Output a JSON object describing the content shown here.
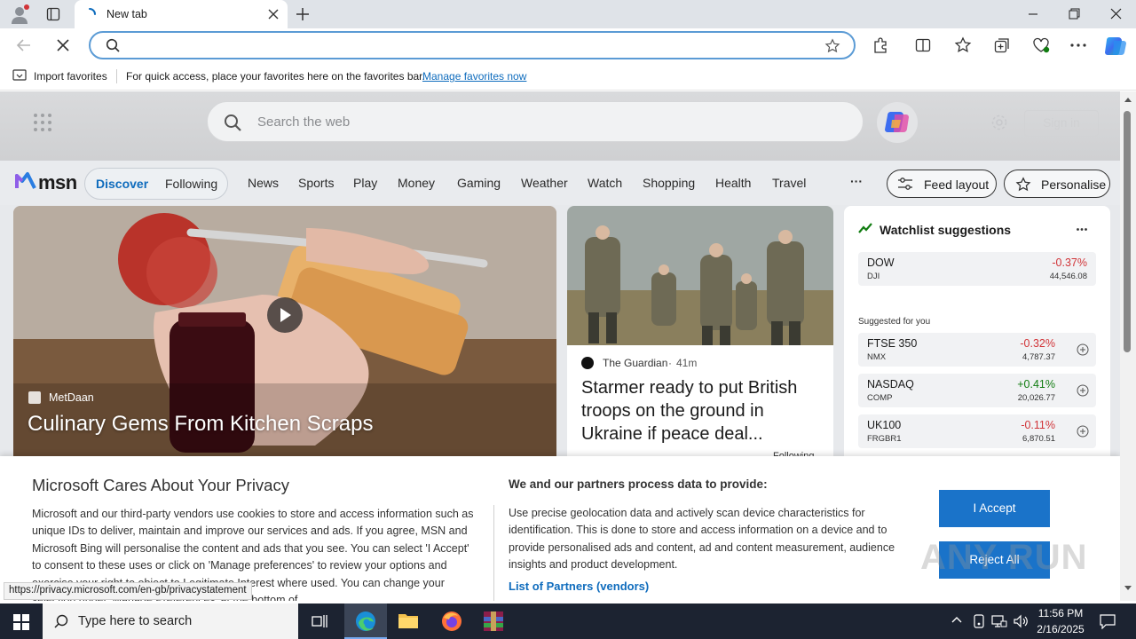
{
  "browser": {
    "tab_title": "New tab",
    "new_tab_symbol": "+",
    "fav_import": "Import favorites",
    "fav_hint": "For quick access, place your favorites here on the favorites bar.",
    "fav_manage_link": "Manage favorites now",
    "status_url": "https://privacy.microsoft.com/en-gb/privacystatement"
  },
  "msn": {
    "search_placeholder": "Search the web",
    "sign_in": "Sign in",
    "logo_text": "msn",
    "pill": [
      "Discover",
      "Following"
    ],
    "nav": [
      "News",
      "Sports",
      "Play",
      "Money",
      "Gaming",
      "Weather",
      "Watch",
      "Shopping",
      "Health",
      "Travel"
    ],
    "more": "···",
    "feed_layout": "Feed layout",
    "personalise": "Personalise"
  },
  "hero": {
    "source": "MetDaan",
    "headline": "Culinary Gems From Kitchen Scraps"
  },
  "news": {
    "source": "The Guardian",
    "age": "41m",
    "headline": "Starmer ready to put British troops on the ground in Ukraine if peace deal...",
    "following": "Following"
  },
  "watchlist": {
    "title": "Watchlist suggestions",
    "suggested_label": "Suggested for you",
    "top": {
      "name": "DOW",
      "symbol": "DJI",
      "change": "-0.37%",
      "price": "44,546.08"
    },
    "items": [
      {
        "name": "FTSE 350",
        "symbol": "NMX",
        "change": "-0.32%",
        "price": "4,787.37",
        "dir": "neg"
      },
      {
        "name": "NASDAQ",
        "symbol": "COMP",
        "change": "+0.41%",
        "price": "20,026.77",
        "dir": "pos"
      },
      {
        "name": "UK100",
        "symbol": "FRGBR1",
        "change": "-0.11%",
        "price": "6,870.51",
        "dir": "neg"
      }
    ]
  },
  "privacy": {
    "title": "Microsoft Cares About Your Privacy",
    "body": "Microsoft and our third-party vendors use cookies to store and access information such as unique IDs to deliver, maintain and improve our services and ads. If you agree, MSN and Microsoft Bing will personalise the content and ads that you see. You can select 'I Accept' to consent to these uses or click on 'Manage preferences' to review your options and exercise your right to object to Legitimate Interest where used. You can change your selection under 'Manage Preferences' at the bottom of",
    "partners_title": "We and our partners process data to provide:",
    "partners_body": "Use precise geolocation data and actively scan device characteristics for identification. This is done to store and access information on a device and to provide personalised ads and content, ad and content measurement, audience insights and product development.",
    "partners_link": "List of Partners (vendors)",
    "accept": "I Accept",
    "reject": "Reject All"
  },
  "watermark": "ANY RUN",
  "taskbar": {
    "search_placeholder": "Type here to search",
    "time": "11:56 PM",
    "date": "2/16/2025"
  }
}
